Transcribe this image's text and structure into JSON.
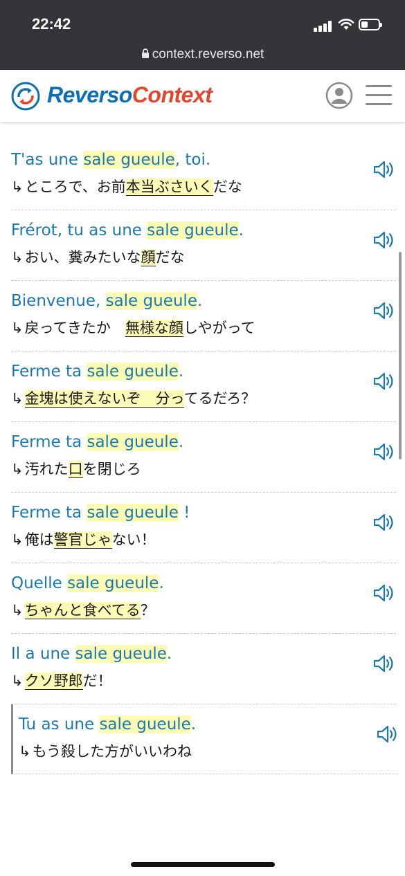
{
  "status_bar": {
    "time": "22:42",
    "url": "context.reverso.net"
  },
  "header": {
    "logo_part1": "Reverso",
    "logo_part2": "Context",
    "colors": {
      "blue": "#0c6fb4",
      "red": "#e2472d"
    }
  },
  "examples": [
    {
      "src_pre": "T'as une ",
      "src_hl": "sale gueule",
      "src_post": ", toi.",
      "arrow": "↳",
      "trg_pre": "ところで、お前",
      "trg_hl": "本当ぶさいく",
      "trg_post": "だな"
    },
    {
      "src_pre": "Frérot, tu as une ",
      "src_hl": "sale gueule",
      "src_post": ".",
      "arrow": "↳",
      "trg_pre": "おい、糞みたいな",
      "trg_hl": "顔",
      "trg_post": "だな"
    },
    {
      "src_pre": "Bienvenue, ",
      "src_hl": "sale gueule",
      "src_post": ".",
      "arrow": "↳",
      "trg_pre": "戻ってきたか　",
      "trg_hl": "無様な顔",
      "trg_post": "しやがって"
    },
    {
      "src_pre": "Ferme ta ",
      "src_hl": "sale gueule",
      "src_post": ".",
      "arrow": "↳",
      "trg_pre": "",
      "trg_hl": "金塊は使えないぞ　分っ",
      "trg_post": "てるだろ？"
    },
    {
      "src_pre": "Ferme ta ",
      "src_hl": "sale gueule",
      "src_post": ".",
      "arrow": "↳",
      "trg_pre": "汚れた",
      "trg_hl": "口",
      "trg_post": "を閉じろ"
    },
    {
      "src_pre": "Ferme ta ",
      "src_hl": "sale gueule",
      "src_post": " !",
      "arrow": "↳",
      "trg_pre": "俺は",
      "trg_hl": "警官じゃ",
      "trg_post": "ない！"
    },
    {
      "src_pre": "Quelle ",
      "src_hl": "sale gueule",
      "src_post": ".",
      "arrow": "↳",
      "trg_pre": "",
      "trg_hl": "ちゃんと食べてる",
      "trg_post": "？"
    },
    {
      "src_pre": "Il a une ",
      "src_hl": "sale gueule",
      "src_post": ".",
      "arrow": "↳",
      "trg_pre": "",
      "trg_hl": "クソ野郎",
      "trg_post": "だ！"
    },
    {
      "src_pre": "Tu as une ",
      "src_hl": "sale gueule",
      "src_post": ".",
      "arrow": "↳",
      "trg_pre": "もう殺した方がいいわね",
      "trg_hl": "",
      "trg_post": ""
    }
  ],
  "icons": {
    "speaker": "speaker-icon",
    "user": "user-icon",
    "menu": "hamburger-menu-icon",
    "logo": "reverso-logo-icon"
  }
}
